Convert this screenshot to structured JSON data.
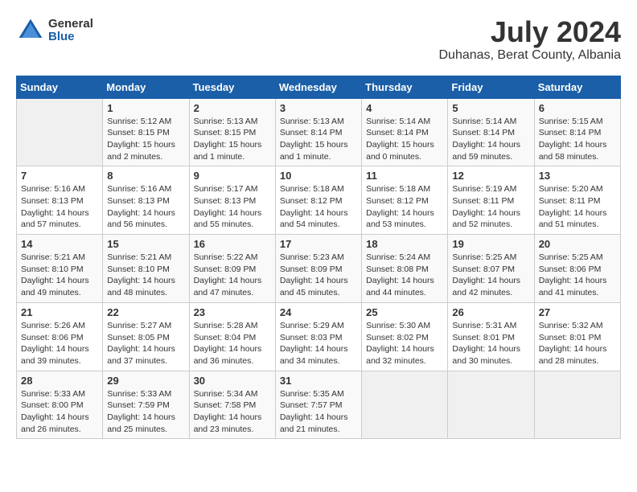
{
  "header": {
    "logo_general": "General",
    "logo_blue": "Blue",
    "month_year": "July 2024",
    "location": "Duhanas, Berat County, Albania"
  },
  "calendar": {
    "weekdays": [
      "Sunday",
      "Monday",
      "Tuesday",
      "Wednesday",
      "Thursday",
      "Friday",
      "Saturday"
    ],
    "weeks": [
      [
        {
          "day": "",
          "detail": ""
        },
        {
          "day": "1",
          "detail": "Sunrise: 5:12 AM\nSunset: 8:15 PM\nDaylight: 15 hours\nand 2 minutes."
        },
        {
          "day": "2",
          "detail": "Sunrise: 5:13 AM\nSunset: 8:15 PM\nDaylight: 15 hours\nand 1 minute."
        },
        {
          "day": "3",
          "detail": "Sunrise: 5:13 AM\nSunset: 8:14 PM\nDaylight: 15 hours\nand 1 minute."
        },
        {
          "day": "4",
          "detail": "Sunrise: 5:14 AM\nSunset: 8:14 PM\nDaylight: 15 hours\nand 0 minutes."
        },
        {
          "day": "5",
          "detail": "Sunrise: 5:14 AM\nSunset: 8:14 PM\nDaylight: 14 hours\nand 59 minutes."
        },
        {
          "day": "6",
          "detail": "Sunrise: 5:15 AM\nSunset: 8:14 PM\nDaylight: 14 hours\nand 58 minutes."
        }
      ],
      [
        {
          "day": "7",
          "detail": "Sunrise: 5:16 AM\nSunset: 8:13 PM\nDaylight: 14 hours\nand 57 minutes."
        },
        {
          "day": "8",
          "detail": "Sunrise: 5:16 AM\nSunset: 8:13 PM\nDaylight: 14 hours\nand 56 minutes."
        },
        {
          "day": "9",
          "detail": "Sunrise: 5:17 AM\nSunset: 8:13 PM\nDaylight: 14 hours\nand 55 minutes."
        },
        {
          "day": "10",
          "detail": "Sunrise: 5:18 AM\nSunset: 8:12 PM\nDaylight: 14 hours\nand 54 minutes."
        },
        {
          "day": "11",
          "detail": "Sunrise: 5:18 AM\nSunset: 8:12 PM\nDaylight: 14 hours\nand 53 minutes."
        },
        {
          "day": "12",
          "detail": "Sunrise: 5:19 AM\nSunset: 8:11 PM\nDaylight: 14 hours\nand 52 minutes."
        },
        {
          "day": "13",
          "detail": "Sunrise: 5:20 AM\nSunset: 8:11 PM\nDaylight: 14 hours\nand 51 minutes."
        }
      ],
      [
        {
          "day": "14",
          "detail": "Sunrise: 5:21 AM\nSunset: 8:10 PM\nDaylight: 14 hours\nand 49 minutes."
        },
        {
          "day": "15",
          "detail": "Sunrise: 5:21 AM\nSunset: 8:10 PM\nDaylight: 14 hours\nand 48 minutes."
        },
        {
          "day": "16",
          "detail": "Sunrise: 5:22 AM\nSunset: 8:09 PM\nDaylight: 14 hours\nand 47 minutes."
        },
        {
          "day": "17",
          "detail": "Sunrise: 5:23 AM\nSunset: 8:09 PM\nDaylight: 14 hours\nand 45 minutes."
        },
        {
          "day": "18",
          "detail": "Sunrise: 5:24 AM\nSunset: 8:08 PM\nDaylight: 14 hours\nand 44 minutes."
        },
        {
          "day": "19",
          "detail": "Sunrise: 5:25 AM\nSunset: 8:07 PM\nDaylight: 14 hours\nand 42 minutes."
        },
        {
          "day": "20",
          "detail": "Sunrise: 5:25 AM\nSunset: 8:06 PM\nDaylight: 14 hours\nand 41 minutes."
        }
      ],
      [
        {
          "day": "21",
          "detail": "Sunrise: 5:26 AM\nSunset: 8:06 PM\nDaylight: 14 hours\nand 39 minutes."
        },
        {
          "day": "22",
          "detail": "Sunrise: 5:27 AM\nSunset: 8:05 PM\nDaylight: 14 hours\nand 37 minutes."
        },
        {
          "day": "23",
          "detail": "Sunrise: 5:28 AM\nSunset: 8:04 PM\nDaylight: 14 hours\nand 36 minutes."
        },
        {
          "day": "24",
          "detail": "Sunrise: 5:29 AM\nSunset: 8:03 PM\nDaylight: 14 hours\nand 34 minutes."
        },
        {
          "day": "25",
          "detail": "Sunrise: 5:30 AM\nSunset: 8:02 PM\nDaylight: 14 hours\nand 32 minutes."
        },
        {
          "day": "26",
          "detail": "Sunrise: 5:31 AM\nSunset: 8:01 PM\nDaylight: 14 hours\nand 30 minutes."
        },
        {
          "day": "27",
          "detail": "Sunrise: 5:32 AM\nSunset: 8:01 PM\nDaylight: 14 hours\nand 28 minutes."
        }
      ],
      [
        {
          "day": "28",
          "detail": "Sunrise: 5:33 AM\nSunset: 8:00 PM\nDaylight: 14 hours\nand 26 minutes."
        },
        {
          "day": "29",
          "detail": "Sunrise: 5:33 AM\nSunset: 7:59 PM\nDaylight: 14 hours\nand 25 minutes."
        },
        {
          "day": "30",
          "detail": "Sunrise: 5:34 AM\nSunset: 7:58 PM\nDaylight: 14 hours\nand 23 minutes."
        },
        {
          "day": "31",
          "detail": "Sunrise: 5:35 AM\nSunset: 7:57 PM\nDaylight: 14 hours\nand 21 minutes."
        },
        {
          "day": "",
          "detail": ""
        },
        {
          "day": "",
          "detail": ""
        },
        {
          "day": "",
          "detail": ""
        }
      ]
    ]
  }
}
